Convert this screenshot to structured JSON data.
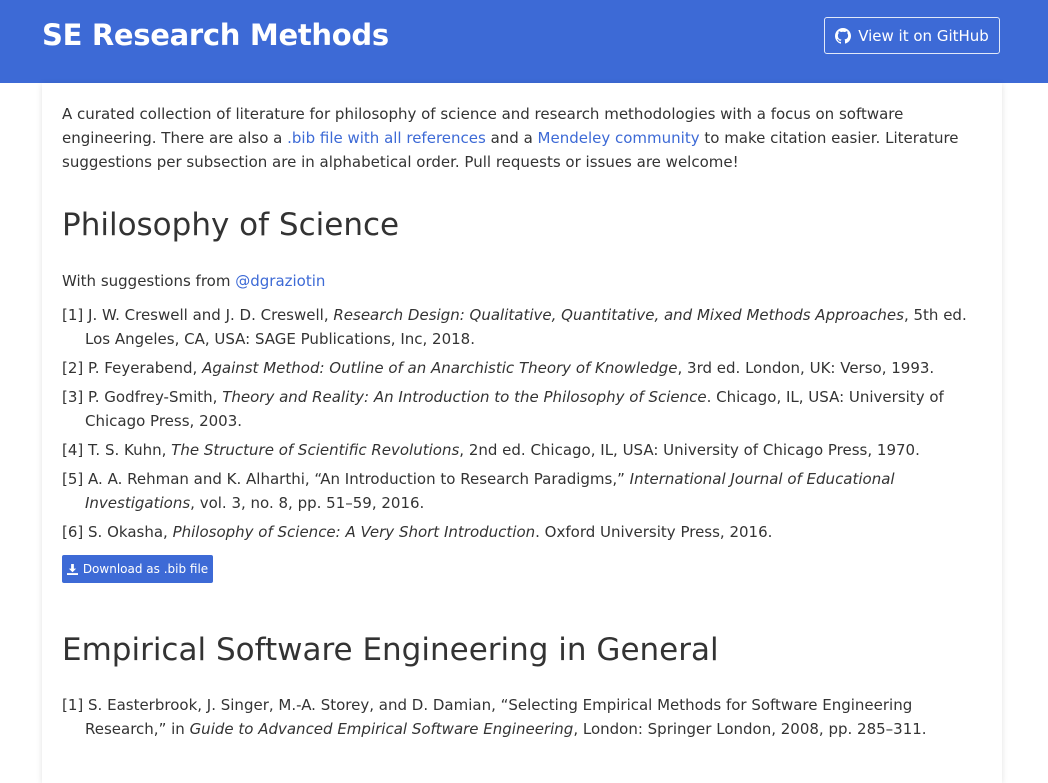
{
  "header": {
    "title": "SE Research Methods",
    "github_button": "View it on GitHub"
  },
  "intro": {
    "text_before": "A curated collection of literature for philosophy of science and research methodologies with a focus on software engineering. There are also a ",
    "bib_link": ".bib file with all references",
    "text_middle": " and a ",
    "mendeley_link": "Mendeley community",
    "text_after": " to make citation easier. Literature suggestions per subsection are in alphabetical order. Pull requests or issues are welcome!"
  },
  "sections": [
    {
      "heading": "Philosophy of Science",
      "suggestions_prefix": "With suggestions from ",
      "suggestions_user": "@dgraziotin",
      "download_label": "Download as .bib file",
      "refs": [
        {
          "num": "[1]",
          "pre": "J. W. Creswell and J. D. Creswell, ",
          "title": "Research Design: Qualitative, Quantitative, and Mixed Methods Approaches",
          "post": ", 5th ed. Los Angeles, CA, USA: SAGE Publications, Inc, 2018."
        },
        {
          "num": "[2]",
          "pre": "P. Feyerabend, ",
          "title": "Against Method: Outline of an Anarchistic Theory of Knowledge",
          "post": ", 3rd ed. London, UK: Verso, 1993."
        },
        {
          "num": "[3]",
          "pre": "P. Godfrey-Smith, ",
          "title": "Theory and Reality: An Introduction to the Philosophy of Science",
          "post": ". Chicago, IL, USA: University of Chicago Press, 2003."
        },
        {
          "num": "[4]",
          "pre": "T. S. Kuhn, ",
          "title": "The Structure of Scientific Revolutions",
          "post": ", 2nd ed. Chicago, IL, USA: University of Chicago Press, 1970."
        },
        {
          "num": "[5]",
          "pre": "A. A. Rehman and K. Alharthi, “An Introduction to Research Paradigms,” ",
          "title": "International Journal of Educational Investigations",
          "post": ", vol. 3, no. 8, pp. 51–59, 2016."
        },
        {
          "num": "[6]",
          "pre": "S. Okasha, ",
          "title": "Philosophy of Science: A Very Short Introduction",
          "post": ". Oxford University Press, 2016."
        }
      ]
    },
    {
      "heading": "Empirical Software Engineering in General",
      "refs": [
        {
          "num": "[1]",
          "pre": "S. Easterbrook, J. Singer, M.-A. Storey, and D. Damian, “Selecting Empirical Methods for Software Engineering Research,” in ",
          "title": "Guide to Advanced Empirical Software Engineering",
          "post": ", London: Springer London, 2008, pp. 285–311."
        }
      ]
    }
  ],
  "icons": {
    "github": "github-icon",
    "download": "download-icon"
  },
  "colors": {
    "brand": "#3d6ad6",
    "text": "#333333"
  }
}
